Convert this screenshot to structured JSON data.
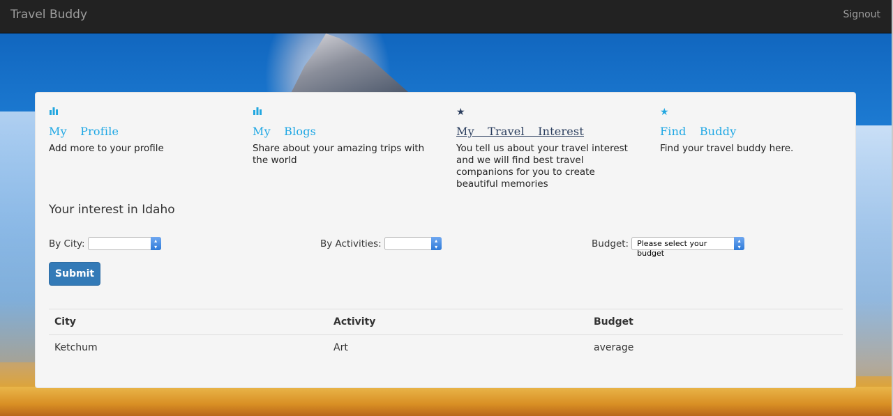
{
  "navbar": {
    "brand": "Travel Buddy",
    "signout": "Signout"
  },
  "features": [
    {
      "icon": "bar-chart-icon",
      "title": "My Profile",
      "desc": "Add more to your profile"
    },
    {
      "icon": "bar-chart-icon",
      "title": "My Blogs",
      "desc": "Share about your amazing trips with the world"
    },
    {
      "icon": "star-icon",
      "title": "My Travel Interest",
      "desc": "You tell us about your travel interest and we will find best travel companions for you to create beautiful memories"
    },
    {
      "icon": "star-icon",
      "title": "Find Buddy",
      "desc": "Find your travel buddy here."
    }
  ],
  "interest": {
    "heading": "Your interest in Idaho"
  },
  "filters": {
    "city_label": "By City:",
    "city_value": "",
    "activities_label": "By Activities:",
    "activities_value": "",
    "budget_label": "Budget:",
    "budget_value": "Please select your budget"
  },
  "submit_label": "Submit",
  "table": {
    "headers": [
      "City",
      "Activity",
      "Budget"
    ],
    "rows": [
      [
        "Ketchum",
        "Art",
        "average"
      ]
    ]
  },
  "colors": {
    "navbar": "#222222",
    "accent": "#1ea7e4",
    "button": "#337ab7",
    "active_link": "#2b3e5e"
  }
}
